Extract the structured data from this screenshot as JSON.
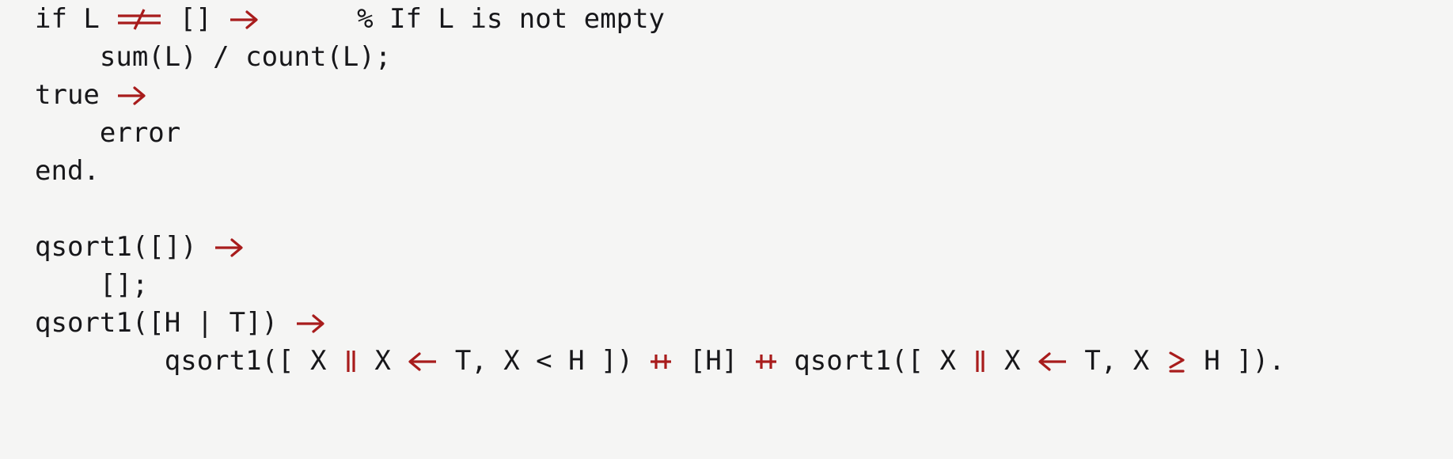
{
  "page": {
    "background_color": "#f5f5f4",
    "text_color": "#17171a",
    "operator_color": "#a81c1c",
    "language": "Erlang",
    "font_style": "monospace-with-ligatures"
  },
  "code": {
    "plain_text": "if L =/= [] ->      % If L is not empty\n    sum(L) / count(L);\ntrue ->\n    error\nend.\n\nqsort1([]) ->\n    [];\nqsort1([H | T]) ->\n        qsort1([ X || X <- T, X < H ]) ++ [H] ++ qsort1([ X || X <- T, X >= H ]).",
    "lines": [
      {
        "id": "line-1",
        "indent": "",
        "tokens": [
          {
            "kind": "plain",
            "text": "if L "
          },
          {
            "kind": "op",
            "glyph": "not-equal",
            "text": "≠"
          },
          {
            "kind": "plain",
            "text": " [] "
          },
          {
            "kind": "op",
            "glyph": "right-arrow",
            "text": "→"
          },
          {
            "kind": "plain",
            "text": "      "
          },
          {
            "kind": "comment",
            "text": "% If L is not empty"
          }
        ]
      },
      {
        "id": "line-2",
        "indent": "    ",
        "tokens": [
          {
            "kind": "plain",
            "text": "    sum(L) / count(L);"
          }
        ]
      },
      {
        "id": "line-3",
        "indent": "",
        "tokens": [
          {
            "kind": "plain",
            "text": "true "
          },
          {
            "kind": "op",
            "glyph": "right-arrow",
            "text": "→"
          }
        ]
      },
      {
        "id": "line-4",
        "indent": "    ",
        "tokens": [
          {
            "kind": "plain",
            "text": "    error"
          }
        ]
      },
      {
        "id": "line-5",
        "indent": "",
        "tokens": [
          {
            "kind": "plain",
            "text": "end."
          }
        ]
      },
      {
        "id": "line-6",
        "indent": "",
        "blank": true,
        "tokens": []
      },
      {
        "id": "line-7",
        "indent": "",
        "tokens": [
          {
            "kind": "plain",
            "text": "qsort1([]) "
          },
          {
            "kind": "op",
            "glyph": "right-arrow",
            "text": "→"
          }
        ]
      },
      {
        "id": "line-8",
        "indent": "    ",
        "tokens": [
          {
            "kind": "plain",
            "text": "    [];"
          }
        ]
      },
      {
        "id": "line-9",
        "indent": "",
        "tokens": [
          {
            "kind": "plain",
            "text": "qsort1([H | T]) "
          },
          {
            "kind": "op",
            "glyph": "right-arrow",
            "text": "→"
          }
        ]
      },
      {
        "id": "line-10",
        "indent": "        ",
        "tokens": [
          {
            "kind": "plain",
            "text": "        qsort1([ X "
          },
          {
            "kind": "op",
            "glyph": "double-pipe",
            "text": "||"
          },
          {
            "kind": "plain",
            "text": " X "
          },
          {
            "kind": "op",
            "glyph": "left-arrow",
            "text": "←"
          },
          {
            "kind": "plain",
            "text": " T, X < H ]) "
          },
          {
            "kind": "op",
            "glyph": "plus-plus",
            "text": "++"
          },
          {
            "kind": "plain",
            "text": " [H] "
          },
          {
            "kind": "op",
            "glyph": "plus-plus",
            "text": "++"
          },
          {
            "kind": "plain",
            "text": " qsort1([ X "
          },
          {
            "kind": "op",
            "glyph": "double-pipe",
            "text": "||"
          },
          {
            "kind": "plain",
            "text": " X "
          },
          {
            "kind": "op",
            "glyph": "left-arrow",
            "text": "←"
          },
          {
            "kind": "plain",
            "text": " T, X "
          },
          {
            "kind": "op",
            "glyph": "greater-equal",
            "text": "≥"
          },
          {
            "kind": "plain",
            "text": " H ])."
          }
        ]
      }
    ]
  }
}
